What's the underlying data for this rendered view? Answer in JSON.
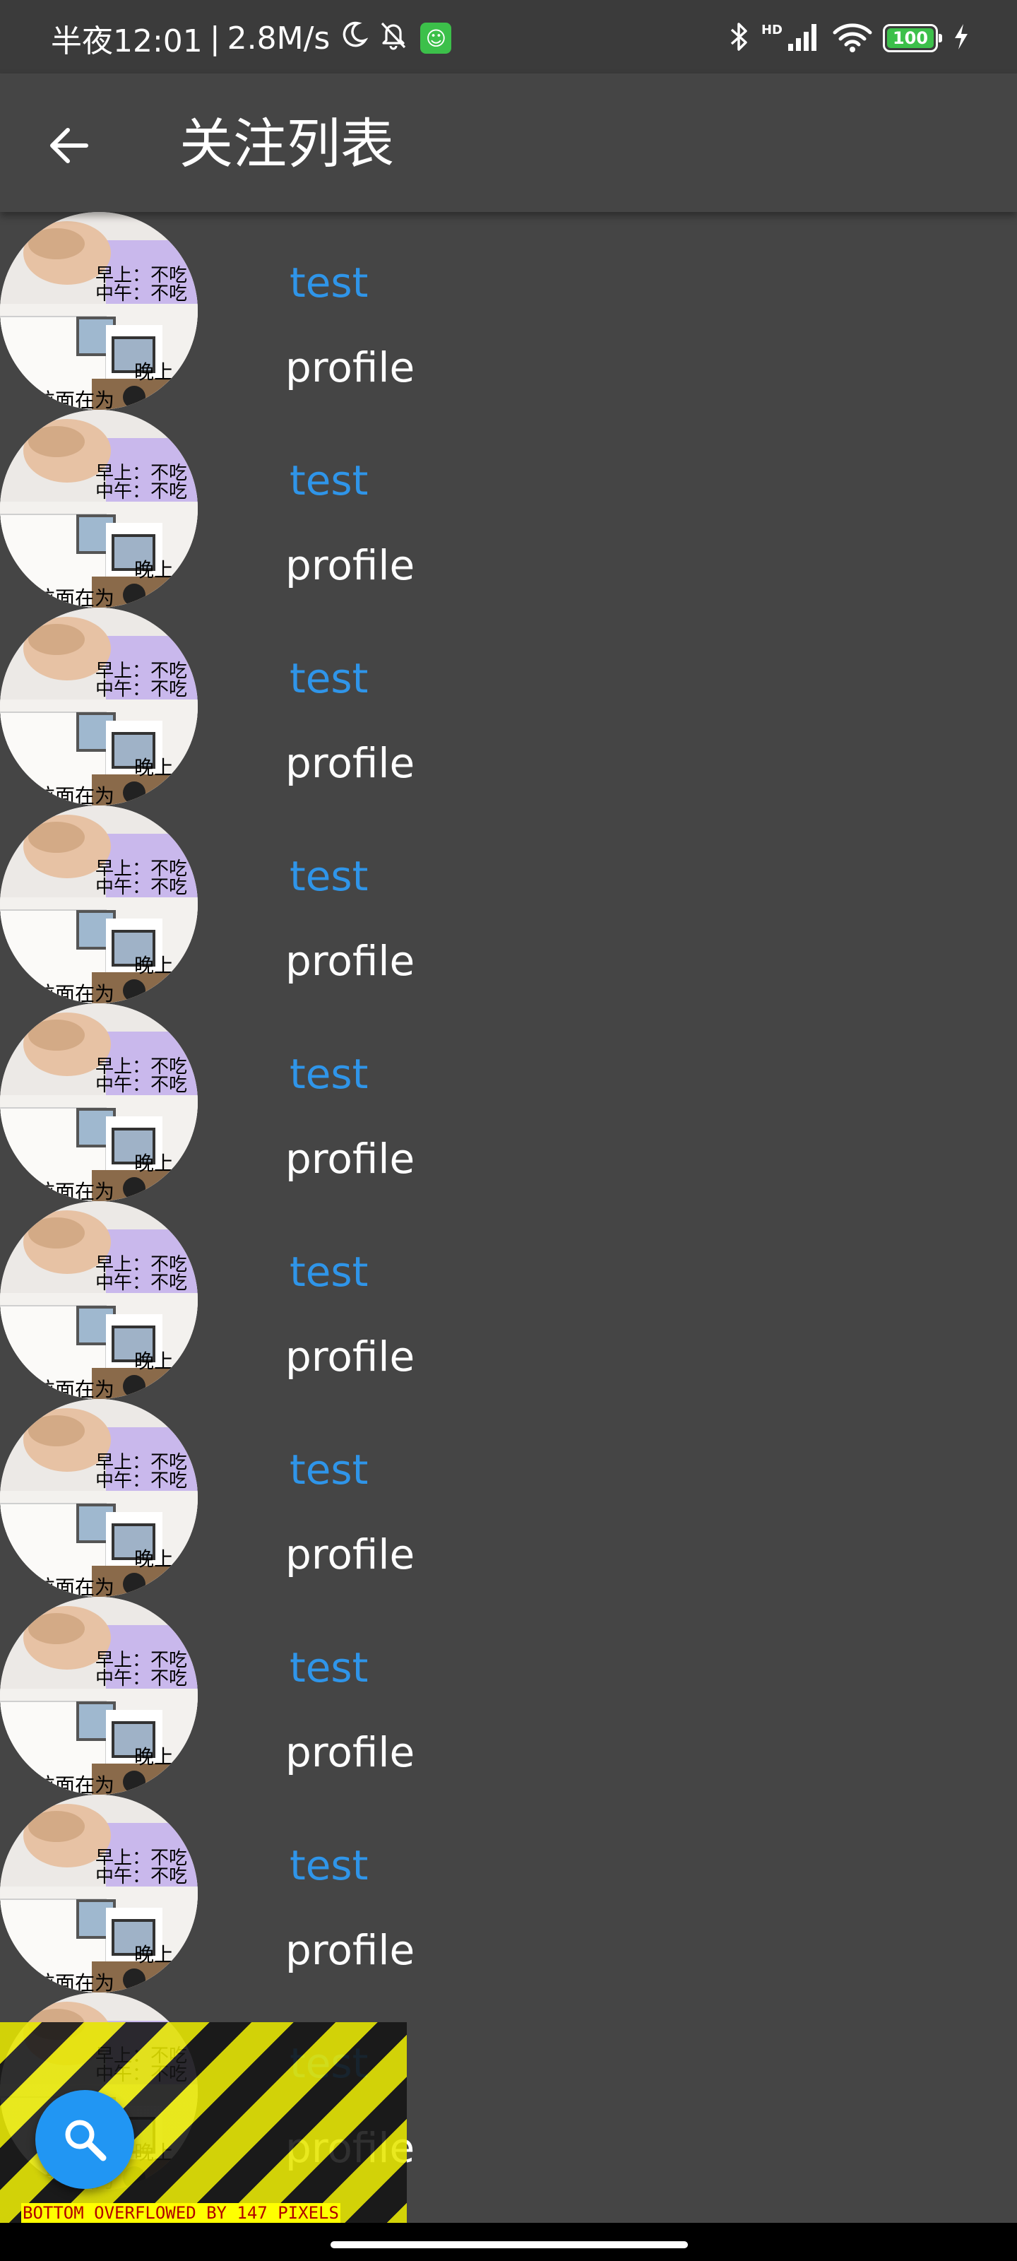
{
  "status_bar": {
    "time": "半夜12:01",
    "separator": "|",
    "network_speed": "2.8M/s",
    "icons_left": [
      "moon-icon",
      "bell-off-icon",
      "app-notification-icon"
    ],
    "icons_right": [
      "bluetooth-icon",
      "hd-signal-icon",
      "wifi-icon",
      "battery-icon",
      "charging-icon"
    ],
    "hd_label": "HD",
    "battery_level": "100",
    "battery_color": "#3cc04a"
  },
  "app_bar": {
    "title": "关注列表",
    "back_icon": "arrow-back-icon"
  },
  "list": {
    "items": [
      {
        "name": "test",
        "profile": "profile"
      },
      {
        "name": "test",
        "profile": "profile"
      },
      {
        "name": "test",
        "profile": "profile"
      },
      {
        "name": "test",
        "profile": "profile"
      },
      {
        "name": "test",
        "profile": "profile"
      },
      {
        "name": "test",
        "profile": "profile"
      },
      {
        "name": "test",
        "profile": "profile"
      },
      {
        "name": "test",
        "profile": "profile"
      },
      {
        "name": "test",
        "profile": "profile"
      },
      {
        "name": "test",
        "profile": "profile"
      }
    ],
    "avatar_text": {
      "line1": "早上：不吃",
      "line2": "中午：不吃",
      "line3": "晚上",
      "line4": "拉面在为"
    }
  },
  "overflow_warning": "BOTTOM OVERFLOWED BY 147 PIXELS",
  "fab": {
    "icon": "search-icon"
  },
  "colors": {
    "background": "#454545",
    "name_text": "#2f95e9",
    "fab": "#2196f3",
    "status_bar": "#3b3b3b"
  }
}
